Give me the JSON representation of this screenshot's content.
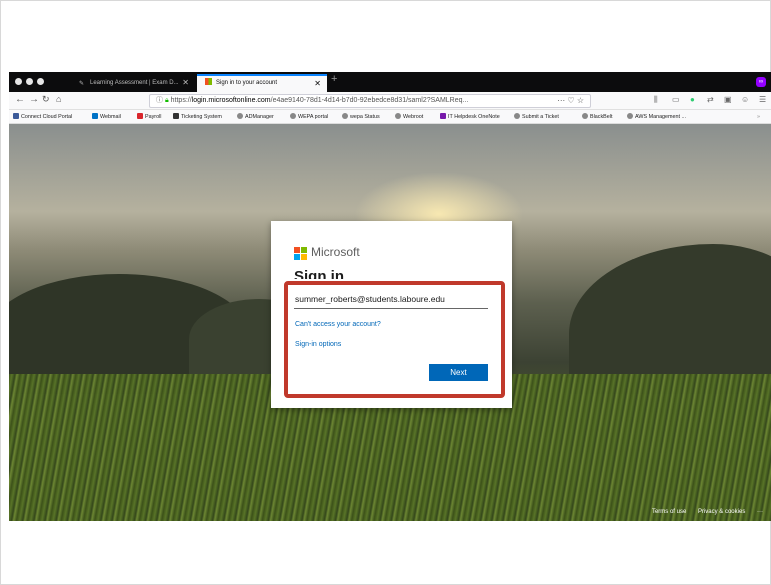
{
  "browser": {
    "tabs": [
      {
        "label": "Learning Assessment | Exam D...",
        "active": false
      },
      {
        "label": "Sign in to your account",
        "active": true
      }
    ],
    "url": {
      "protocol": "https://",
      "host": "login.microsoftonline.com",
      "path": "/e4ae9140-78d1-4d14-b7d0-92ebedce8d31/saml2?SAMLReq..."
    },
    "url_bar_icons": "··· ♡ ☆",
    "bookmarks": [
      "Connect Cloud Portal",
      "Webmail",
      "Payroll",
      "Ticketing System",
      "ADManager",
      "WEPA portal",
      "wepa Status",
      "Webroot",
      "IT Helpdesk OneNote",
      "Submit a Ticket",
      "BlackBelt",
      "AWS Management ..."
    ],
    "extension_badge": "∞"
  },
  "signin": {
    "brand": "Microsoft",
    "title": "Sign in",
    "email_value": "summer_roberts@students.laboure.edu",
    "cant_access_link": "Can't access your account?",
    "signin_options_link": "Sign-in options",
    "next_button": "Next",
    "logo_colors": [
      "#f25022",
      "#7fba00",
      "#00a4ef",
      "#ffb900"
    ],
    "accent_color": "#0067b8"
  },
  "footer": {
    "terms": "Terms of use",
    "privacy": "Privacy & cookies",
    "more": "···"
  },
  "annotation": {
    "highlight_color": "#c0392b"
  }
}
